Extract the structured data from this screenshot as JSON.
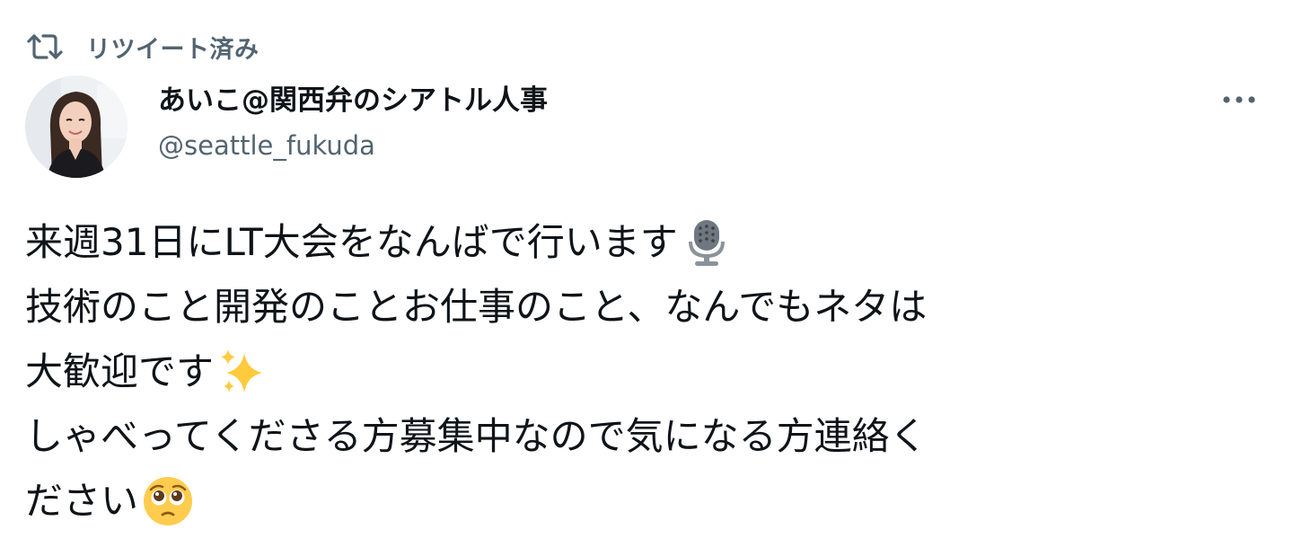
{
  "retweet": {
    "label": "リツイート済み",
    "icon": "retweet-icon"
  },
  "author": {
    "display_name": "あいこ@関西弁のシアトル人事",
    "handle": "@seattle_fukuda",
    "avatar": "avatar"
  },
  "more_icon": "more-icon",
  "body": {
    "lines": [
      {
        "text": "来週31日にLT大会をなんばで行います",
        "emoji": "microphone-emoji"
      },
      {
        "text": "技術のこと開発のことお仕事のこと、なんでもネタは",
        "emoji": ""
      },
      {
        "text": "大歓迎です",
        "emoji": "sparkles-emoji"
      },
      {
        "text": "しゃべってくださる方募集中なので気になる方連絡く",
        "emoji": ""
      },
      {
        "text": "ださい",
        "emoji": "pleading-face-emoji"
      }
    ]
  },
  "colors": {
    "text": "#0f1419",
    "secondary": "#536471",
    "background": "#ffffff"
  }
}
